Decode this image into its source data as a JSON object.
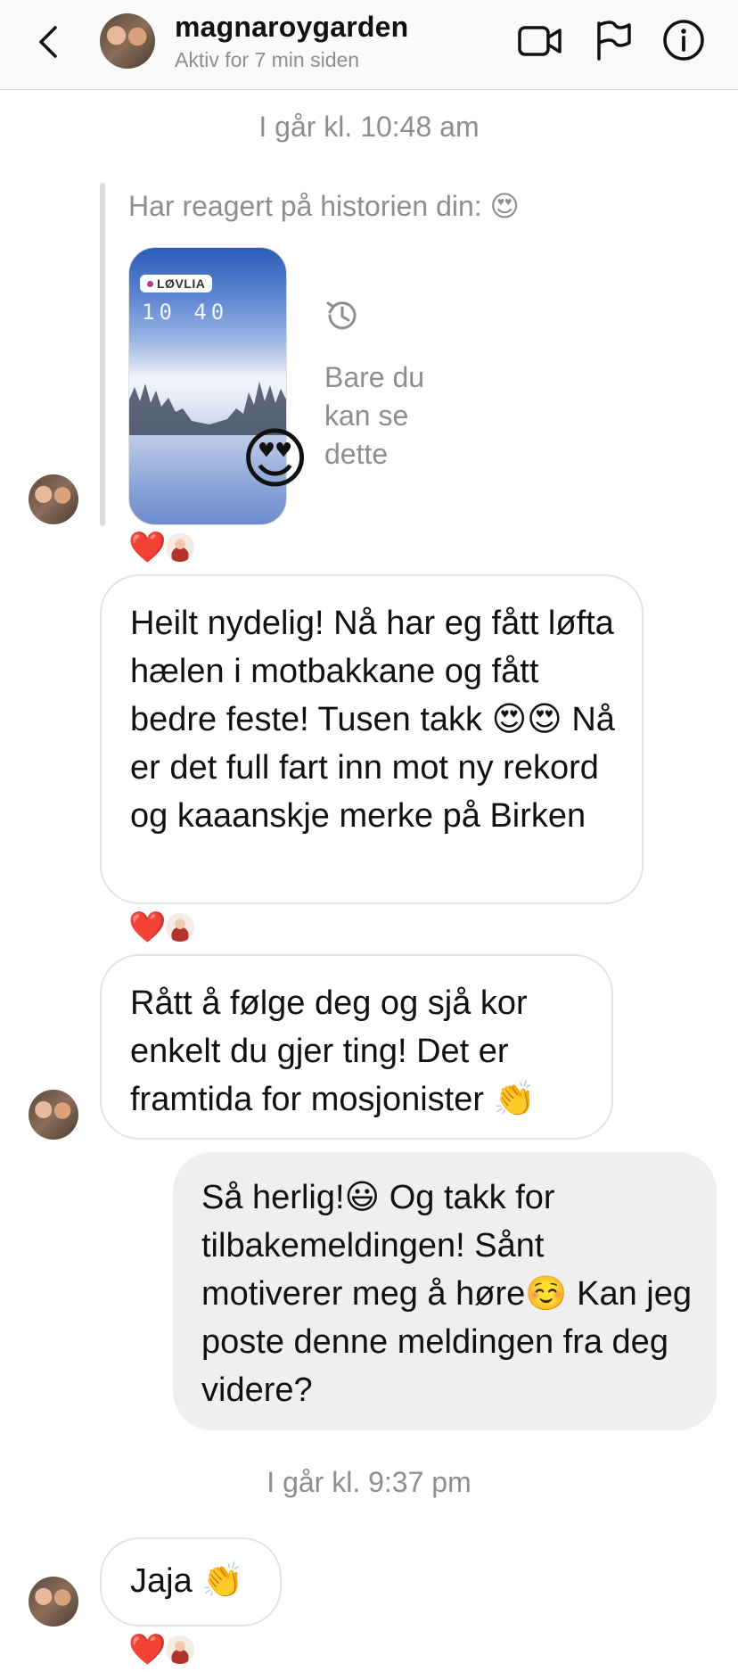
{
  "header": {
    "username": "magnaroygarden",
    "status": "Aktiv for 7 min siden",
    "icons": [
      "back-chevron-icon",
      "video-call-icon",
      "flag-icon",
      "info-icon"
    ]
  },
  "timestamps": [
    "I går kl. 10:48 am",
    "I går kl. 9:37 pm"
  ],
  "story_reply": {
    "label": "Har reagert på historien din: 😍",
    "story_location": "LØVLIA",
    "story_clock": "10 40",
    "reaction_emoji": "😍",
    "visibility_note": "Bare du kan se dette"
  },
  "messages": [
    {
      "from": "them",
      "text": "Heilt nydelig! Nå har eg fått løfta hælen i motbakkane og fått bedre feste! Tusen takk 😍😍 Nå er det full fart inn mot ny rekord og kaaanskje merke på Birken"
    },
    {
      "from": "them",
      "text": "Rått å følge deg og sjå kor enkelt du gjer ting! Det er framtida for mosjonister 👏"
    },
    {
      "from": "me",
      "text": "Så herlig!😃 Og takk for tilbakemeldingen! Sånt motiverer meg å høre☺️ Kan jeg poste denne meldingen fra deg videre?"
    },
    {
      "from": "them",
      "text": "Jaja 👏"
    }
  ],
  "reactions": {
    "heart": "❤️"
  },
  "colors": {
    "heart": "#ed4956",
    "secondary_text": "#8e8e8e",
    "outgoing_bubble": "#efefef",
    "incoming_border": "#e3e3e3"
  }
}
